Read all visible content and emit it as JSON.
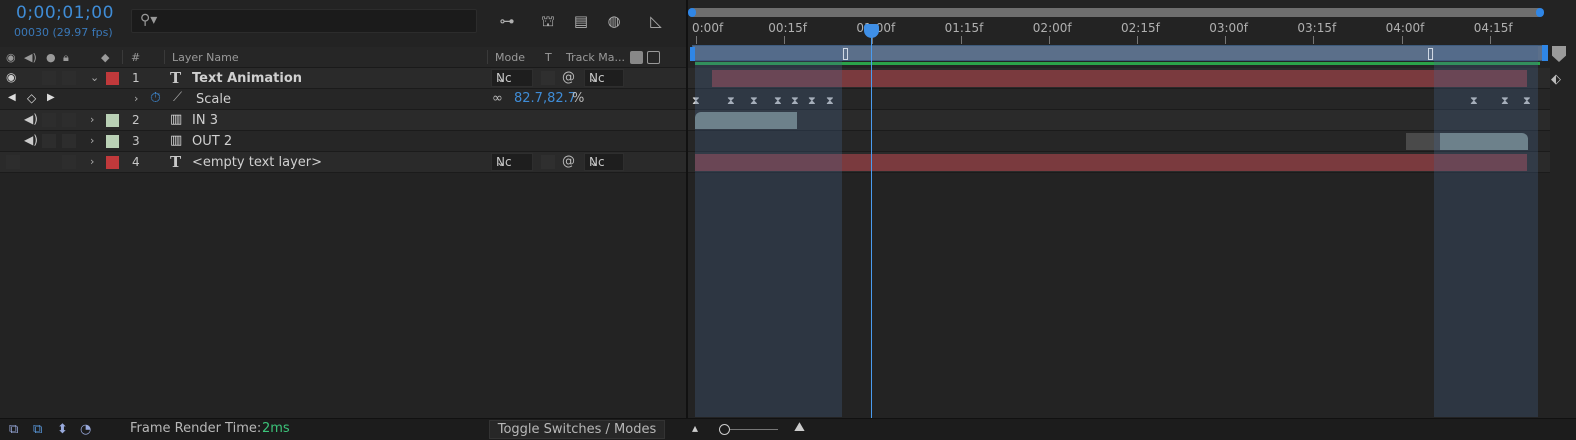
{
  "header": {
    "timecode": "0;00;01;00",
    "fps_line": "00030 (29.97 fps)",
    "search_glyph": "⚲▾"
  },
  "columns": {
    "num": "#",
    "layer_name": "Layer Name",
    "mode": "Mode",
    "t": "T",
    "track_matte": "Track Ma..."
  },
  "layers": [
    {
      "num": "1",
      "name": "Text Animation",
      "type_glyph": "T",
      "color": "#c0393b",
      "mode": "Nc",
      "matte": "Nc"
    },
    {
      "num": "2",
      "name": "IN 3",
      "type_glyph": "▥",
      "color": "#b9d0b5"
    },
    {
      "num": "3",
      "name": "OUT 2",
      "type_glyph": "▥",
      "color": "#b9d0b5"
    },
    {
      "num": "4",
      "name": "<empty text layer>",
      "type_glyph": "T",
      "color": "#c0393b",
      "mode": "Nc",
      "matte": "Nc"
    }
  ],
  "property": {
    "name": "Scale",
    "value": "82.7,82.7",
    "unit": "%"
  },
  "ruler": {
    "ticks": [
      "0:00f",
      "00:15f",
      "01:00f",
      "01:15f",
      "02:00f",
      "02:15f",
      "03:00f",
      "03:15f",
      "04:00f",
      "04:15f"
    ]
  },
  "footer": {
    "frame_render_label": "Frame Render Time:",
    "frame_render_value": "2ms",
    "toggle_label": "Toggle Switches / Modes"
  },
  "colors": {
    "accent": "#3f8cd6",
    "layer_red": "#c0393b",
    "layer_green": "#b9d0b5"
  }
}
